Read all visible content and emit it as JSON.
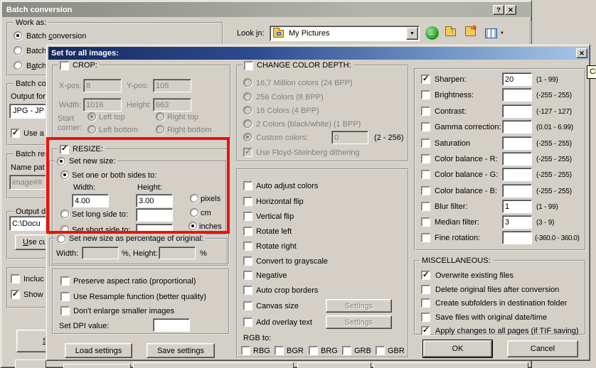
{
  "icons": {
    "help": "?",
    "close": "✕",
    "dropdown": "▼",
    "back_arrow": "←",
    "up_arrow": "↑",
    "new_badge": "✱"
  },
  "colors": {
    "face": "#d4d0c8",
    "highlight_red": "#e8140c",
    "dialog_titlebar_left": "#16295d",
    "dialog_titlebar_right": "#a9c6e8"
  },
  "tooltip_text": "Cl",
  "window": {
    "title": "Batch conversion",
    "look_in_pre": "Look ",
    "look_in_key": "i",
    "look_in_post": "n:",
    "look_in_value": "My Pictures",
    "work_as_label": "Work as:",
    "option1_pre": "Batch ",
    "option1_key": "c",
    "option1_post": "onversion",
    "option2_label": "Batch",
    "option3_pre": "B",
    "option3_key": "a",
    "option3_post": "tch",
    "batch_settings_caption": "Batch co",
    "output_format_label": "Output for",
    "output_format_value": "JPG - JP",
    "use_advanced_label": "Use a",
    "batch_rename_caption": "Batch rer",
    "name_pattern_label": "Name pat",
    "name_pattern_value": "image##",
    "output_dir_caption": "Output di",
    "output_dir_value": "C:\\Docu",
    "use_current_key": "U",
    "use_current_post": "se cu",
    "start_button_key": "S"
  },
  "dialog": {
    "title": "Set for all images:",
    "crop": {
      "caption": "CROP:",
      "xpos_label": "X-pos:",
      "xpos_value": "8",
      "ypos_label": "Y-pos:",
      "ypos_value": "105",
      "width_label": "Width:",
      "width_value": "1016",
      "height_label": "Height:",
      "height_value": "663",
      "start_label": "Start",
      "corner_label": "corner:",
      "corners": [
        "Left top",
        "Right top",
        "Left bottom",
        "Right bottom"
      ]
    },
    "resize": {
      "caption": "RESIZE:",
      "set_new_size_label": "Set new size:",
      "one_or_both_label": "Set one or both sides to:",
      "width_label": "Width:",
      "width_value": "4.00",
      "height_label": "Height:",
      "height_value": "3.00",
      "long_side_label": "Set long side to:",
      "long_side_value": "",
      "short_side_label": "Set short side to:",
      "short_side_value": "",
      "units": [
        "pixels",
        "cm",
        "inches"
      ],
      "percent_caption": "Set new size as percentage of original:",
      "percent_width_label": "Width:",
      "percent_width_value": "",
      "percent_mid_label": "%, Height:",
      "percent_height_value": "",
      "percent_suffix": "%"
    },
    "options": {
      "items": [
        "Preserve aspect ratio (proportional)",
        "Use Resample function (better quality)",
        "Don't enlarge smaller images"
      ],
      "dpi_label": "Set DPI value:",
      "dpi_value": ""
    },
    "load_settings_label": "Load settings",
    "save_settings_label": "Save settings",
    "color_depth": {
      "caption": "CHANGE COLOR DEPTH:",
      "options": [
        "16,7 Million colors (24 BPP)",
        "256 Colors (8 BPP)",
        "16 Colors (4 BPP)",
        "2 Colors (black/white) (1 BPP)"
      ],
      "custom_label": "Custom colors:",
      "custom_value": "0",
      "custom_range": "(2 - 256)",
      "dither_label": "Use Floyd-Steinberg dithering"
    },
    "transform": {
      "items": [
        "Auto adjust colors",
        "Horizontal flip",
        "Vertical flip",
        "Rotate left",
        "Rotate right",
        "Convert to grayscale",
        "Negative",
        "Auto crop borders",
        "Canvas size",
        "Add overlay text"
      ],
      "settings_label": "Settings",
      "rgb_caption": "RGB to:",
      "rgb_options": [
        "RBG",
        "BGR",
        "BRG",
        "GRB",
        "GBR"
      ]
    },
    "filters": [
      {
        "label": "Sharpen:",
        "value": "20",
        "range": "(1 - 99)",
        "checked": true
      },
      {
        "label": "Brightness:",
        "value": "",
        "range": "(-255 - 255)",
        "checked": false
      },
      {
        "label": "Contrast:",
        "value": "",
        "range": "(-127 - 127)",
        "checked": false
      },
      {
        "label": "Gamma correction:",
        "value": "",
        "range": "(0.01 - 6.99)",
        "checked": false
      },
      {
        "label": "Saturation",
        "value": "",
        "range": "(-255 - 255)",
        "checked": false
      },
      {
        "label": "Color balance - R:",
        "value": "",
        "range": "(-255 - 255)",
        "checked": false
      },
      {
        "label": "Color balance - G:",
        "value": "",
        "range": "(-255 - 255)",
        "checked": false
      },
      {
        "label": "Color balance - B:",
        "value": "",
        "range": "(-255 - 255)",
        "checked": false
      },
      {
        "label": "Blur filter:",
        "value": "1",
        "range": "(1 - 99)",
        "checked": false
      },
      {
        "label": "Median filter:",
        "value": "3",
        "range": "(3 - 9)",
        "checked": false
      },
      {
        "label": "Fine rotation:",
        "value": "",
        "range": "(-360.0 - 360.0)",
        "checked": false
      }
    ],
    "misc": {
      "caption": "MISCELLANEOUS:",
      "items": [
        {
          "label": "Overwrite existing files",
          "checked": true
        },
        {
          "label": "Delete original files after conversion",
          "checked": false
        },
        {
          "label": "Create subfolders in destination folder",
          "checked": false
        },
        {
          "label": "Save files with original date/time",
          "checked": false
        },
        {
          "label": "Apply changes to all pages (if TIF saving)",
          "checked": true
        }
      ]
    },
    "ok_label": "OK",
    "cancel_label": "Cancel"
  }
}
